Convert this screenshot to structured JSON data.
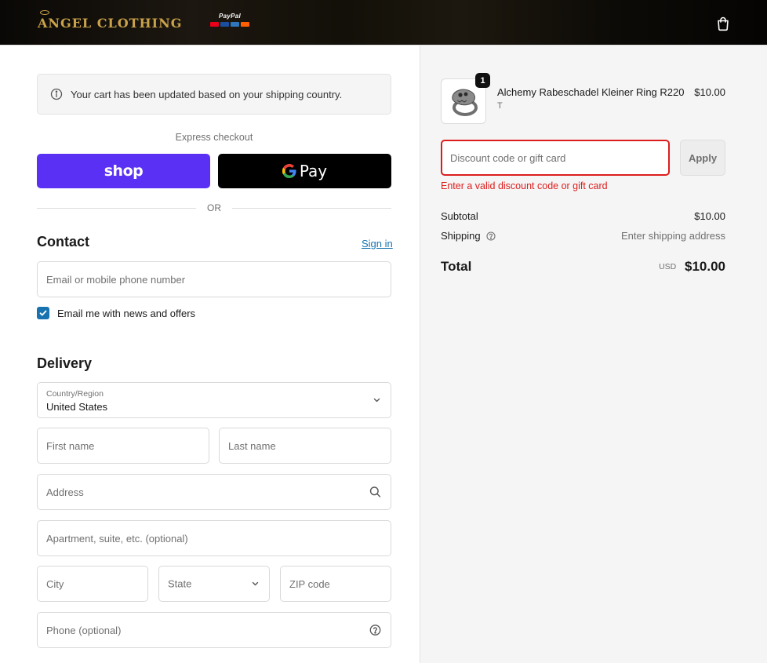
{
  "header": {
    "brand": "ANGEL CLOTHING",
    "paypal_label": "PayPal",
    "card_colors": [
      "#eb001b",
      "#1a4fa0",
      "#2e77bc",
      "#ff5f00"
    ]
  },
  "notice": {
    "text": "Your cart has been updated based on your shipping country."
  },
  "express": {
    "label": "Express checkout",
    "shop_label": "shop",
    "gpay_label": "Pay",
    "or_label": "OR"
  },
  "contact": {
    "title": "Contact",
    "sign_in": "Sign in",
    "email_placeholder": "Email or mobile phone number",
    "newsletter_label": "Email me with news and offers",
    "newsletter_checked": true
  },
  "delivery": {
    "title": "Delivery",
    "country_label": "Country/Region",
    "country_value": "United States",
    "first_name_placeholder": "First name",
    "last_name_placeholder": "Last name",
    "address_placeholder": "Address",
    "apartment_placeholder": "Apartment, suite, etc. (optional)",
    "city_placeholder": "City",
    "state_placeholder": "State",
    "zip_placeholder": "ZIP code",
    "phone_placeholder": "Phone (optional)"
  },
  "summary": {
    "product": {
      "name": "Alchemy Rabeschadel Kleiner Ring R220",
      "variant": "T",
      "price": "$10.00",
      "quantity": "1"
    },
    "discount_placeholder": "Discount code or gift card",
    "apply_label": "Apply",
    "discount_error": "Enter a valid discount code or gift card",
    "subtotal_label": "Subtotal",
    "subtotal_value": "$10.00",
    "shipping_label": "Shipping",
    "shipping_value": "Enter shipping address",
    "total_label": "Total",
    "total_currency": "USD",
    "total_value": "$10.00"
  },
  "colors": {
    "shop_purple": "#5a31f4",
    "link_blue": "#1773b0",
    "error_red": "#dd1d1d",
    "brand_gold": "#c9a24a"
  }
}
